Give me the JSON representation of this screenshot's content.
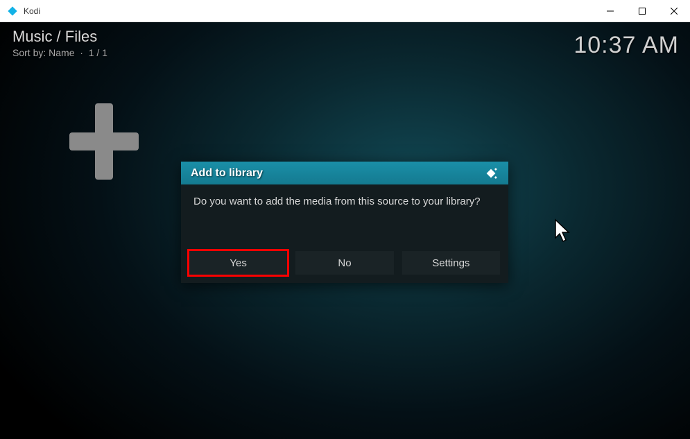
{
  "window": {
    "title": "Kodi"
  },
  "header": {
    "breadcrumb": "Music / Files",
    "sort_label": "Sort by: Name",
    "page_label": "1 / 1",
    "clock": "10:37 AM"
  },
  "dialog": {
    "title": "Add to library",
    "message": "Do you want to add the media from this source to your library?",
    "buttons": {
      "yes": "Yes",
      "no": "No",
      "settings": "Settings"
    }
  }
}
